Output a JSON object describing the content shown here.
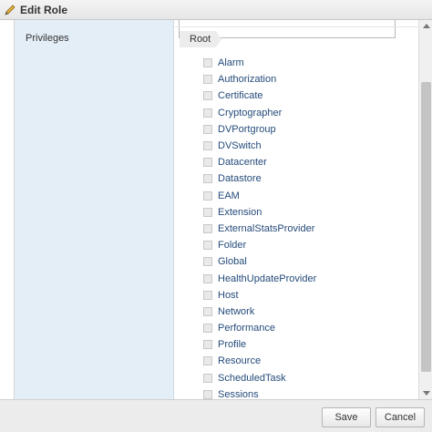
{
  "window": {
    "title": "Edit Role",
    "icon": "pencil-icon"
  },
  "form": {
    "privileges_label": "Privileges"
  },
  "tree": {
    "breadcrumb": "Root",
    "items": [
      "Alarm",
      "Authorization",
      "Certificate",
      "Cryptographer",
      "DVPortgroup",
      "DVSwitch",
      "Datacenter",
      "Datastore",
      "EAM",
      "Extension",
      "ExternalStatsProvider",
      "Folder",
      "Global",
      "HealthUpdateProvider",
      "Host",
      "Network",
      "Performance",
      "Profile",
      "Resource",
      "ScheduledTask",
      "Sessions"
    ]
  },
  "footer": {
    "save_label": "Save",
    "cancel_label": "Cancel"
  },
  "colors": {
    "left_panel": "#e4eef6",
    "link_text": "#244b7a",
    "footer": "#ececec"
  }
}
